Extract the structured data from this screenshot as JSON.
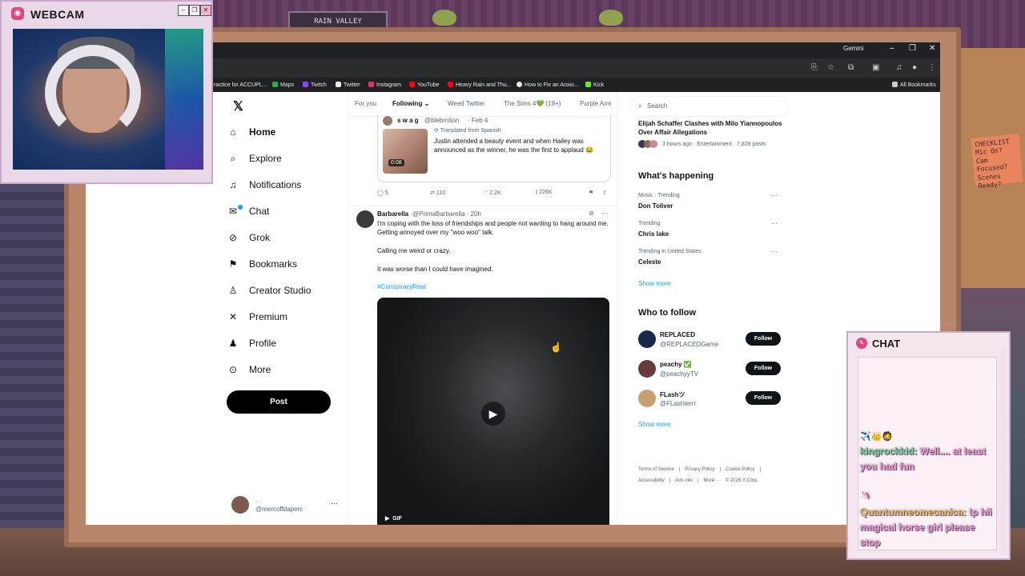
{
  "browser": {
    "gemini_label": "Gemini",
    "bookmarks": [
      {
        "label": "ractice for ACCUPL...",
        "color": "#8ab4f8"
      },
      {
        "label": "Maps",
        "color": "#34a853"
      },
      {
        "label": "Twitch",
        "color": "#9146ff"
      },
      {
        "label": "Twitter",
        "color": "#e8eaed"
      },
      {
        "label": "Instagram",
        "color": "#e1306c"
      },
      {
        "label": "YouTube",
        "color": "#ff0000"
      },
      {
        "label": "Heavy Rain and Thu...",
        "color": "#ff0000"
      },
      {
        "label": "How to Fix an Anxio...",
        "color": "#e8eaed"
      },
      {
        "label": "Kick",
        "color": "#53fc18"
      }
    ],
    "all_bookmarks": "All Bookmarks"
  },
  "nav": {
    "items": [
      {
        "label": "Home",
        "icon": "home-icon"
      },
      {
        "label": "Explore",
        "icon": "search-icon"
      },
      {
        "label": "Notifications",
        "icon": "bell-icon"
      },
      {
        "label": "Chat",
        "icon": "chat-icon"
      },
      {
        "label": "Grok",
        "icon": "grok-icon"
      },
      {
        "label": "Bookmarks",
        "icon": "bookmark-icon"
      },
      {
        "label": "Creator Studio",
        "icon": "creator-icon"
      },
      {
        "label": "Premium",
        "icon": "x-icon"
      },
      {
        "label": "Profile",
        "icon": "person-icon"
      },
      {
        "label": "More",
        "icon": "more-icon"
      }
    ],
    "post_label": "Post",
    "account": {
      "name": ".",
      "handle": "@mercoffdaperc"
    }
  },
  "tabs": [
    "For you",
    "Following",
    "Weed Twitter",
    "The Sims 4💚 (18+)",
    "Purple Arm"
  ],
  "quote": {
    "name": "s w a g",
    "handle": "@blebrntion",
    "date": "· Feb 4",
    "translated": "Translated from Spanish",
    "text": "Justin attended a beauty event and when Hailey was announced as the winner, he was the first to applaud 😂",
    "duration": "0:08"
  },
  "actions": {
    "replies": "5",
    "reposts": "110",
    "likes": "2.2K",
    "views": "226K"
  },
  "post": {
    "name": "Barbarella",
    "handle": "@PrimaBarbarella · 20h",
    "para1": "I'm coping with the loss of friendships and people not wanting to hang around me. Getting annoyed over my \"woo woo\" talk.",
    "para2": "Calling me weird or crazy.",
    "para3": "It was worse than I could have imagined.",
    "hashtag": "#ConspiracyReal",
    "gif_label": "GIF"
  },
  "right": {
    "search_placeholder": "Search",
    "top_trend": {
      "title": "Elijah Schaffer Clashes with Milo Yiannopoulos Over Affair Allegations",
      "meta": "3 hours ago · Entertainment · 7,828 posts"
    },
    "happening_title": "What's happening",
    "trends": [
      {
        "category": "Music · Trending",
        "name": "Don Toliver"
      },
      {
        "category": "Trending",
        "name": "Chris lake"
      },
      {
        "category": "Trending in United States",
        "name": "Celeste"
      }
    ],
    "show_more": "Show more",
    "follow_title": "Who to follow",
    "follow": [
      {
        "name": "REPLACED",
        "handle": "@REPLACEDGame",
        "color": "#1a2a4a"
      },
      {
        "name": "peachy ✅",
        "handle": "@peachyyTV",
        "color": "#6a3a3a"
      },
      {
        "name": "FLashツ",
        "handle": "@FLashterrr",
        "color": "#c8a070"
      }
    ],
    "follow_label": "Follow",
    "show_more_2": "Show more",
    "footer": [
      "Terms of Service",
      "|",
      "Privacy Policy",
      "|",
      "Cookie Policy",
      "|",
      "Accessibility",
      "|",
      "Ads info",
      "|",
      "More ···",
      "© 2026 X Corp."
    ]
  },
  "webcam": {
    "title": "WEBCAM"
  },
  "chat": {
    "title": "CHAT",
    "messages": [
      {
        "emotes": "✈️👑🧔",
        "user": "kingrockkid:",
        "user_color": "#5fd68a",
        "text": "Well.... at least you had fun"
      },
      {
        "emotes": "🦄",
        "user": "Quantumneomecanica:",
        "user_color": "#e8c25a",
        "text": "!p hii magical horse girl please stop"
      }
    ]
  },
  "background": {
    "shelf_label": "RAIN VALLEY",
    "note_text": "CHECKLIST Mic On? Cam Focused? Scenes Ready?"
  }
}
